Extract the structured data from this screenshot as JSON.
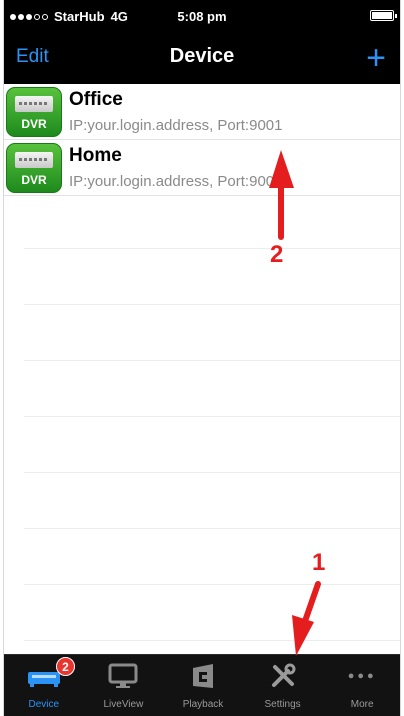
{
  "status_bar": {
    "carrier": "StarHub",
    "network": "4G",
    "time": "5:08 pm"
  },
  "nav": {
    "edit_label": "Edit",
    "title": "Device",
    "add_label": "+"
  },
  "devices": [
    {
      "name": "Office",
      "address": "IP:your.login.address, Port:9001",
      "icon_label": "DVR"
    },
    {
      "name": "Home",
      "address": "IP:your.login.address, Port:9000",
      "icon_label": "DVR"
    }
  ],
  "tabs": [
    {
      "label": "Device",
      "icon": "device-icon",
      "badge": "2",
      "active": true
    },
    {
      "label": "LiveView",
      "icon": "monitor-icon",
      "active": false
    },
    {
      "label": "Playback",
      "icon": "playback-icon",
      "active": false
    },
    {
      "label": "Settings",
      "icon": "tools-icon",
      "active": false
    },
    {
      "label": "More",
      "icon": "more-dots-icon",
      "active": false
    }
  ],
  "annotations": [
    {
      "number": "1"
    },
    {
      "number": "2"
    }
  ],
  "colors": {
    "accent": "#2a93f5",
    "annotation": "#e41e1e",
    "dvr_green": "#3aa62d",
    "badge_red": "#e8352e"
  }
}
